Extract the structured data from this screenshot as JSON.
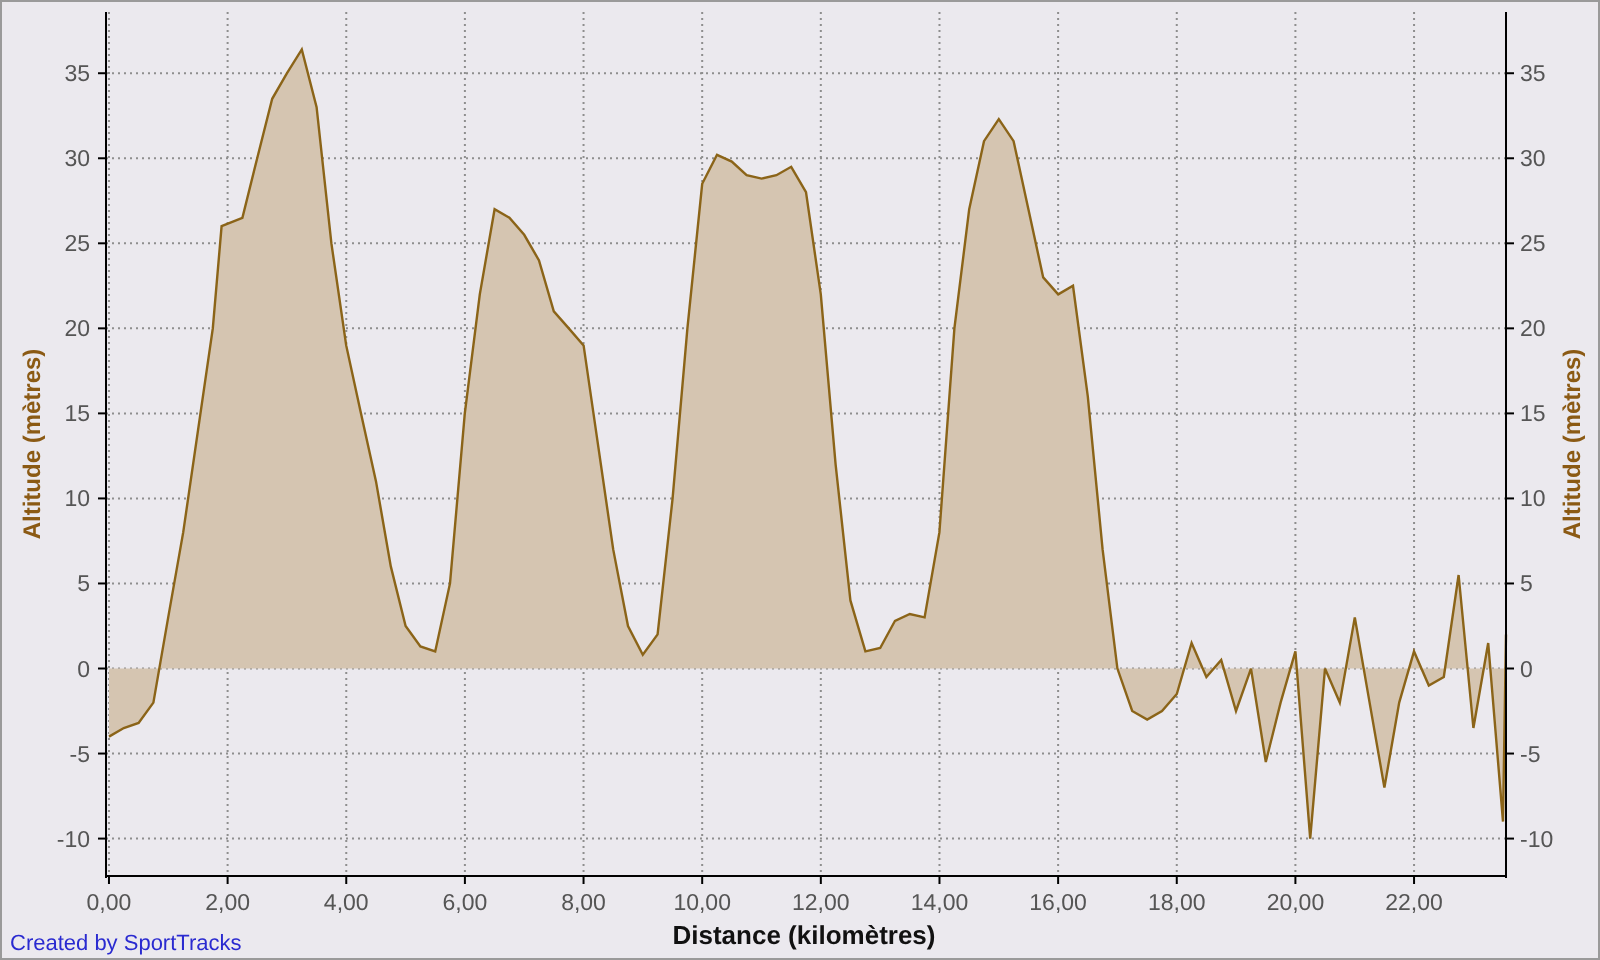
{
  "chart": {
    "chart_data": {
      "type": "area",
      "xlabel": "Distance (kilomètres)",
      "ylabel": "Altitude (mètres)",
      "x": [
        0,
        0.25,
        0.5,
        0.75,
        1,
        1.25,
        1.5,
        1.75,
        1.9,
        2.25,
        2.5,
        2.75,
        3,
        3.25,
        3.5,
        3.75,
        4,
        4.25,
        4.5,
        4.75,
        5,
        5.25,
        5.5,
        5.75,
        6,
        6.25,
        6.5,
        6.75,
        7,
        7.25,
        7.5,
        7.75,
        8,
        8.25,
        8.5,
        8.75,
        9,
        9.25,
        9.5,
        9.75,
        10,
        10.25,
        10.5,
        10.75,
        11,
        11.25,
        11.5,
        11.75,
        12,
        12.25,
        12.5,
        12.75,
        13,
        13.25,
        13.5,
        13.75,
        14,
        14.25,
        14.5,
        14.75,
        15,
        15.25,
        15.5,
        15.75,
        16,
        16.25,
        16.5,
        16.75,
        17,
        17.25,
        17.5,
        17.75,
        18,
        18.25,
        18.5,
        18.75,
        19,
        19.25,
        19.5,
        19.75,
        20,
        20.25,
        20.5,
        20.75,
        21,
        21.25,
        21.5,
        21.75,
        22,
        22.25,
        22.5,
        22.75,
        23,
        23.25,
        23.5,
        23.55
      ],
      "series": [
        {
          "color": "#8b6418",
          "values": [
            -4,
            -3.5,
            -3.2,
            -2,
            3,
            8,
            14,
            20,
            26,
            26.5,
            30,
            33.5,
            35,
            36.4,
            33,
            25,
            19,
            15,
            11,
            6,
            2.5,
            1.3,
            1,
            5,
            15,
            22,
            27,
            26.5,
            25.5,
            24,
            21,
            20,
            19,
            13,
            7,
            2.5,
            0.8,
            2,
            10,
            20,
            28.5,
            30.2,
            29.8,
            29,
            28.8,
            29,
            29.5,
            28,
            22,
            12,
            4,
            1,
            1.2,
            2.8,
            3.2,
            3,
            8,
            20,
            27,
            31,
            32.3,
            31,
            27,
            23,
            22,
            22.5,
            16,
            7,
            0,
            -2.5,
            -3,
            -2.5,
            -1.5,
            1.5,
            -0.5,
            0.5,
            -2.5,
            0,
            -5.5,
            -2,
            1,
            -10,
            0,
            -2,
            3,
            -2,
            -7,
            -2,
            1,
            -1,
            -0.5,
            5.5,
            -3.5,
            1.5,
            -9,
            2
          ]
        }
      ],
      "grid": true,
      "xlim": [
        -0.05,
        23.55
      ],
      "ylim": [
        -12.2,
        38.6
      ],
      "xticks": [
        {
          "value": 0,
          "label": "0,00"
        },
        {
          "value": 2,
          "label": "2,00"
        },
        {
          "value": 4,
          "label": "4,00"
        },
        {
          "value": 6,
          "label": "6,00"
        },
        {
          "value": 8,
          "label": "8,00"
        },
        {
          "value": 10,
          "label": "10,00"
        },
        {
          "value": 12,
          "label": "12,00"
        },
        {
          "value": 14,
          "label": "14,00"
        },
        {
          "value": 16,
          "label": "16,00"
        },
        {
          "value": 18,
          "label": "18,00"
        },
        {
          "value": 20,
          "label": "20,00"
        },
        {
          "value": 22,
          "label": "22,00"
        }
      ],
      "yticks": [
        {
          "value": -10,
          "label": "-10"
        },
        {
          "value": -5,
          "label": "-5"
        },
        {
          "value": 0,
          "label": "0"
        },
        {
          "value": 5,
          "label": "5"
        },
        {
          "value": 10,
          "label": "10"
        },
        {
          "value": 15,
          "label": "15"
        },
        {
          "value": 20,
          "label": "20"
        },
        {
          "value": 25,
          "label": "25"
        },
        {
          "value": 30,
          "label": "30"
        },
        {
          "value": 35,
          "label": "35"
        }
      ]
    },
    "right_axis": {
      "label": "Altitude (mètres)",
      "ticks": [
        "35",
        "30",
        "25",
        "20",
        "15",
        "10",
        "5",
        "0",
        "-5",
        "-10"
      ]
    }
  },
  "credit": "Created by SportTracks"
}
